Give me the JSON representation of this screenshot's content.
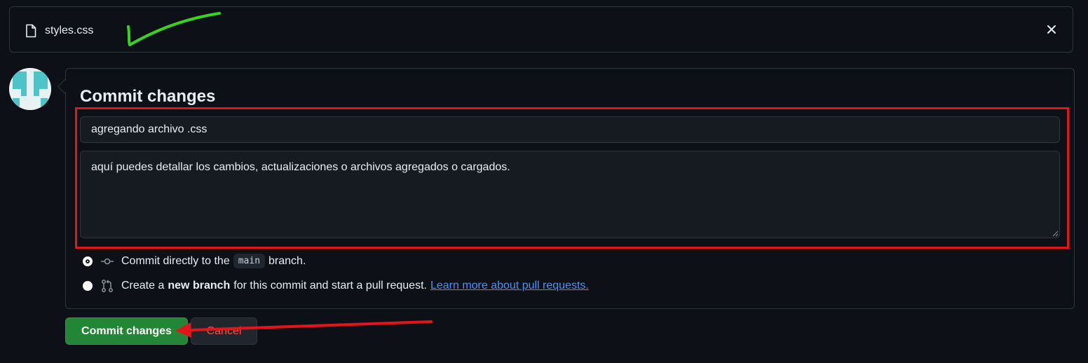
{
  "file_bar": {
    "file_name": "styles.css",
    "file_icon": "file-icon",
    "close_icon": "close-icon"
  },
  "commit_form": {
    "title": "Commit changes",
    "summary_value": "agregando archivo .css",
    "description_value": "aquí puedes detallar los cambios, actualizaciones o archivos agregados o cargados.",
    "options": {
      "direct": {
        "prefix": "Commit directly to the",
        "branch": "main",
        "suffix": "branch.",
        "selected": true,
        "icon": "git-commit-icon"
      },
      "new_branch": {
        "prefix": "Create a",
        "bold": "new branch",
        "suffix": "for this commit and start a pull request.",
        "link": "Learn more about pull requests.",
        "selected": false,
        "icon": "git-pull-request-icon"
      }
    }
  },
  "actions": {
    "commit_label": "Commit changes",
    "cancel_label": "Cancel"
  },
  "colors": {
    "background": "#0d1117",
    "border": "#30363d",
    "accent_green": "#238636",
    "danger_red": "#f85149",
    "annotation_red": "#e3151a",
    "annotation_green": "#39d51d",
    "link_blue": "#4493f8"
  }
}
